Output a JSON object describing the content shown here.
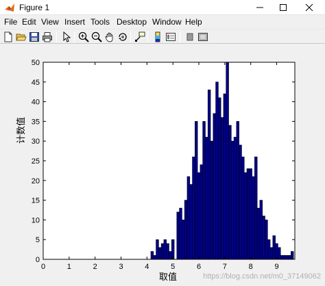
{
  "window": {
    "title": "Figure 1"
  },
  "menu": [
    "File",
    "Edit",
    "View",
    "Insert",
    "Tools",
    "Desktop",
    "Window",
    "Help"
  ],
  "toolbar_icons": [
    "new-file-icon",
    "open-file-icon",
    "save-icon",
    "print-icon",
    "pointer-icon",
    "zoom-in-icon",
    "zoom-out-icon",
    "pan-icon",
    "rotate-3d-icon",
    "data-cursor-icon",
    "colorbar-icon",
    "legend-icon",
    "hide-plot-tools-icon",
    "show-plot-tools-icon"
  ],
  "watermark": "https://blog.csdn.net/m0_37149062",
  "colors": {
    "bar_fill": "#00008b",
    "bar_edge": "#000000",
    "axes_bg": "#ffffff"
  },
  "chart_data": {
    "type": "bar",
    "title": "",
    "xlabel": "取值",
    "ylabel": "计数值",
    "xlim": [
      0,
      9.7
    ],
    "ylim": [
      0,
      50
    ],
    "xticks": [
      0,
      1,
      2,
      3,
      4,
      5,
      6,
      7,
      8,
      9
    ],
    "yticks": [
      0,
      5,
      10,
      15,
      20,
      25,
      30,
      35,
      40,
      45,
      50
    ],
    "bin_width": 0.1,
    "x": [
      4.2,
      4.3,
      4.4,
      4.5,
      4.6,
      4.7,
      4.8,
      4.9,
      5.0,
      5.1,
      5.2,
      5.3,
      5.4,
      5.5,
      5.6,
      5.7,
      5.8,
      5.9,
      6.0,
      6.1,
      6.2,
      6.3,
      6.4,
      6.5,
      6.6,
      6.7,
      6.8,
      6.9,
      7.0,
      7.1,
      7.2,
      7.3,
      7.4,
      7.5,
      7.6,
      7.7,
      7.8,
      7.9,
      8.0,
      8.1,
      8.2,
      8.3,
      8.4,
      8.5,
      8.6,
      8.7,
      8.8,
      8.9,
      9.0,
      9.1,
      9.2,
      9.3,
      9.4,
      9.5,
      9.6
    ],
    "values": [
      2,
      1,
      5,
      3,
      4,
      5,
      4,
      2,
      5,
      0,
      12,
      13,
      10,
      15,
      21,
      19,
      26,
      35,
      22,
      24,
      35,
      31,
      43,
      30,
      37,
      45,
      41,
      36,
      42,
      50,
      34,
      30,
      31,
      35,
      29,
      26,
      22,
      23,
      23,
      21,
      26,
      13,
      15,
      11,
      10,
      5,
      3,
      6,
      4,
      3,
      1,
      1,
      1,
      1,
      2
    ],
    "grid": false,
    "legend": "none"
  }
}
